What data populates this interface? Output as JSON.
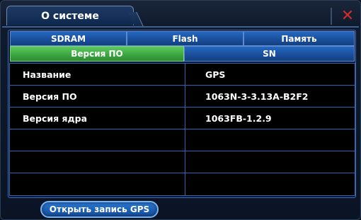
{
  "window": {
    "title": "О системе",
    "close_symbol": "✕"
  },
  "tabs_row1": [
    "SDRAM",
    "Flash",
    "Память"
  ],
  "tabs_row2": [
    "Версия ПО",
    "SN"
  ],
  "active_tab": "Версия ПО",
  "info_rows": [
    {
      "label": "Название",
      "value": "GPS"
    },
    {
      "label": "Версия ПО",
      "value": "1063N-3-3.13A-B2F2"
    },
    {
      "label": "Версия ядра",
      "value": "1063FB-1.2.9"
    },
    {
      "label": "",
      "value": ""
    },
    {
      "label": "",
      "value": ""
    },
    {
      "label": "",
      "value": ""
    }
  ],
  "footer": {
    "gps_button_label": "Открыть запись GPS"
  },
  "colors": {
    "active_tab": "#3ca741",
    "tab": "#1a4f9c",
    "close": "#d22b2b",
    "grid_line": "#2f64b0"
  }
}
